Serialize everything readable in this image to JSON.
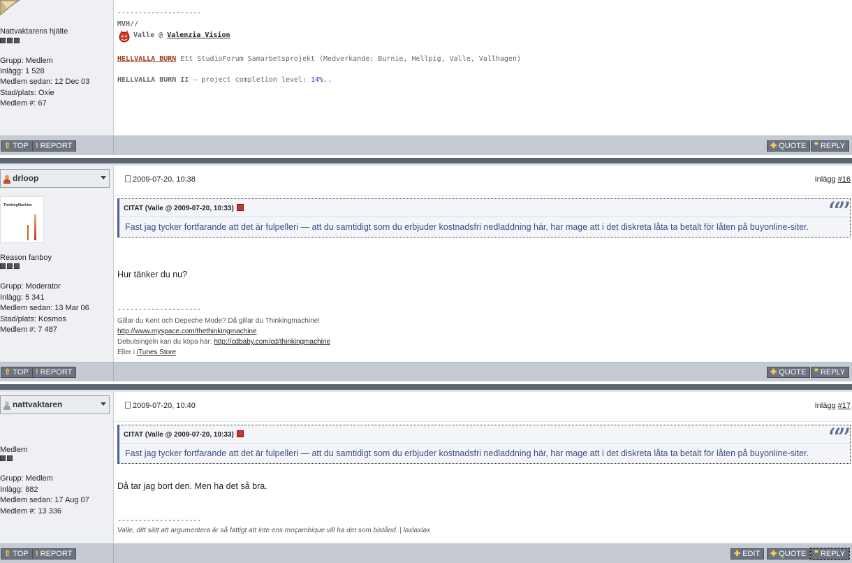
{
  "post1": {
    "user_title": "Nattvaktarens hjälte",
    "group": "Grupp: Medlem",
    "posts": "Inlägg: 1 528",
    "member_since": "Medlem sedan: 12 Dec 03",
    "location": "Stad/plats: Oxie",
    "member_no": "Medlem #: 67",
    "sig_divider": "--------------------",
    "sig_mvh": "MVH//",
    "sig_valle": "Valle @",
    "sig_valenzia": "Valenzia Vision",
    "sig_hb_title": "HELLVALLA BURN",
    "sig_hb_text": "Ett StudioForum Samarbetsprojekt (Medverkande: Burnie, Hellpig, Valle, Vallhagen)",
    "sig_hb2": "HELLVALLA BURN II",
    "sig_hb2_text": "— project completion level:",
    "sig_hb2_pct": "14%.."
  },
  "post2": {
    "username": "drloop",
    "date": "2009-07-20, 10:38",
    "post_label": "Inlägg",
    "post_no": "#16",
    "user_title": "Reason fanboy",
    "avatar_text": "ThinkingMachine",
    "group": "Grupp: Moderator",
    "posts": "Inlägg: 5 341",
    "member_since": "Medlem sedan: 13 Mar 06",
    "location": "Stad/plats: Kosmos",
    "member_no": "Medlem #: 7 487",
    "quote_head": "CITAT (Valle @ 2009-07-20, 10:33)",
    "quote_text": "Fast jag tycker fortfarande att det är fulpelleri — att du samtidigt som du erbjuder kostnadsfri nedladdning här, har mage att i det diskreta låta ta betalt för låten på buyonline-siter.",
    "body": "Hur tänker du nu?",
    "sig_divider": "--------------------",
    "sig_line1": "Gillar du Kent och Depeche Mode? Då gillar du Thinkingmachine!",
    "sig_link1": "http://www.myspace.com/thethinkingmachine",
    "sig_line3_prefix": "Debutsingeln kan du köpa här:",
    "sig_link2": "http://cdbaby.com/cd/thinkingmachine",
    "sig_line4_prefix": "Eller i",
    "sig_link3": "iTunes Store"
  },
  "post3": {
    "username": "nattvaktaren",
    "date": "2009-07-20, 10:40",
    "post_label": "Inlägg",
    "post_no": "#17",
    "user_title": "Medlem",
    "group": "Grupp: Medlem",
    "posts": "Inlägg: 882",
    "member_since": "Medlem sedan: 17 Aug 07",
    "member_no": "Medlem #: 13 336",
    "quote_head": "CITAT (Valle @ 2009-07-20, 10:33)",
    "quote_text": "Fast jag tycker fortfarande att det är fulpelleri — att du samtidigt som du erbjuder kostnadsfri nedladdning här, har mage att i det diskreta låta ta betalt för låten på buyonline-siter.",
    "body": "Då tar jag bort den. Men ha det så bra.",
    "sig_divider": "--------------------",
    "sig_line1": "Valle, ditt sätt att argumentera är så fattigt att inte ens moçambique vill ha det som bistånd. | laxlaxlax"
  },
  "buttons": {
    "top": "TOP",
    "report": "REPORT",
    "quote": "QUOTE",
    "reply": "REPLY",
    "edit": "EDIT"
  },
  "colors": {
    "accent": "#47609a",
    "bar": "#c5cad3",
    "separator": "#5d6673",
    "hellvalla_link": "#9b3a1a",
    "percent": "#1a35b8"
  }
}
